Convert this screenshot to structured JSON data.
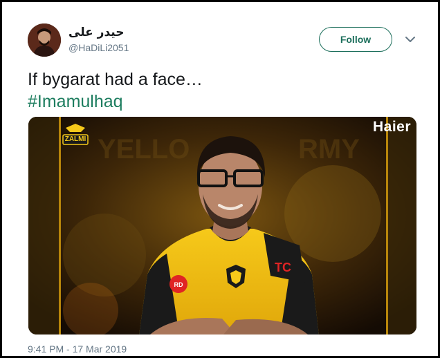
{
  "author": {
    "display_name": "حیدر علی",
    "handle": "@HaDiLi2051"
  },
  "actions": {
    "follow_label": "Follow",
    "menu_icon": "chevron-down-icon"
  },
  "tweet": {
    "text_line1": "If bygarat had a face…",
    "hashtag": "#Imamulhaq",
    "timestamp": "9:41 PM - 17 Mar 2019"
  },
  "media": {
    "sponsor_logo": "Haier",
    "team_logo": "ZALMI",
    "shirt_sponsor": "TC",
    "badge_text": "RD",
    "accent_color": "#f4c20d"
  },
  "colors": {
    "follow": "#1d6f5c",
    "hashtag": "#1d7d5f",
    "muted": "#657786"
  }
}
